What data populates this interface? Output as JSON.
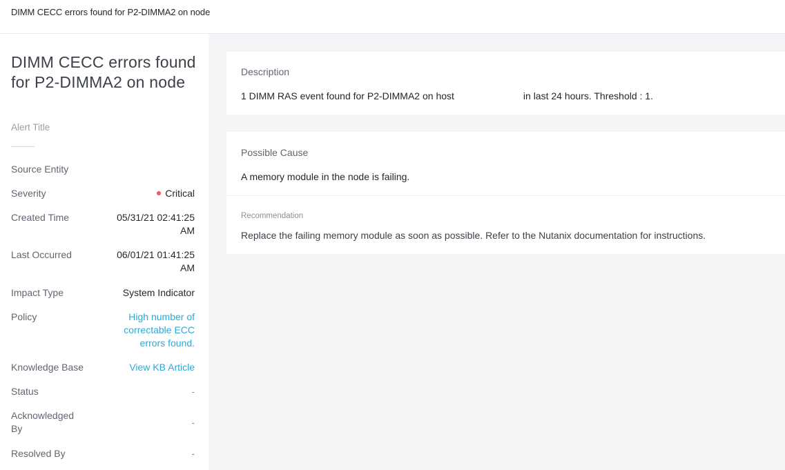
{
  "window": {
    "title": "DIMM CECC errors found for P2-DIMMA2 on node"
  },
  "sidebar": {
    "heading": "DIMM CECC errors found for P2-DIMMA2 on node",
    "heading_caption": "Alert Title",
    "properties": {
      "source_entity": {
        "label": "Source Entity",
        "value": ""
      },
      "severity": {
        "label": "Severity",
        "value": "Critical",
        "color": "#f05a5a"
      },
      "created_time": {
        "label": "Created Time",
        "value_line1": "05/31/21 02:41:25",
        "value_line2": "AM"
      },
      "last_occurred": {
        "label": "Last Occurred",
        "value_line1": "06/01/21 01:41:25",
        "value_line2": "AM"
      },
      "impact_type": {
        "label": "Impact Type",
        "value": "System Indicator"
      },
      "policy": {
        "label": "Policy",
        "value_line1": "High number of",
        "value_line2": "correctable ECC",
        "value_line3": "errors found."
      },
      "knowledge_base": {
        "label": "Knowledge Base",
        "value": "View KB Article"
      },
      "status": {
        "label": "Status",
        "value": "-"
      },
      "acknowledged_by": {
        "label_line1": "Acknowledged",
        "label_line2": "By",
        "value": "-"
      },
      "resolved_by": {
        "label": "Resolved By",
        "value": "-"
      }
    }
  },
  "main": {
    "description": {
      "label": "Description",
      "text_part1": "1 DIMM RAS event found for P2-DIMMA2 on host",
      "text_part2": "in last 24 hours. Threshold : 1."
    },
    "possible_cause": {
      "label": "Possible Cause",
      "text": "A memory module in the node is failing."
    },
    "recommendation": {
      "label": "Recommendation",
      "text": "Replace the failing memory module as soon as possible. Refer to the Nutanix documentation for instructions."
    }
  },
  "colors": {
    "link": "#2aa8d8",
    "critical": "#f05a5a",
    "background": "#f4f5f7"
  }
}
